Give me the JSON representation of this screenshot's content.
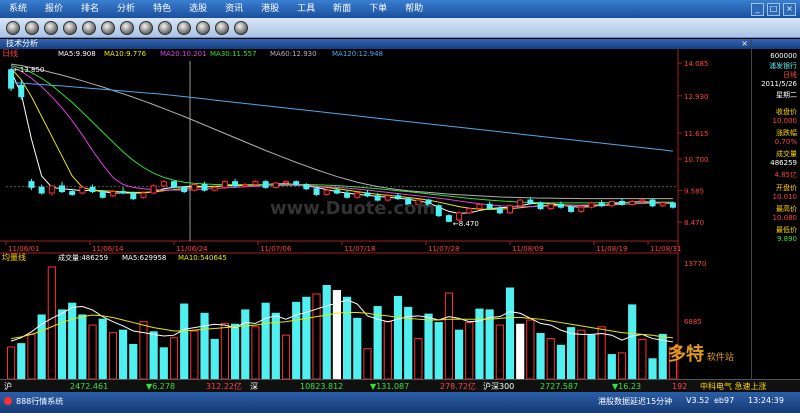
{
  "menu": {
    "items": [
      "系统",
      "报价",
      "排名",
      "分析",
      "特色",
      "选股",
      "资讯",
      "港股",
      "工具",
      "新面",
      "下单",
      "帮助"
    ]
  },
  "window": {
    "min": "_",
    "restore": "□",
    "close": "×"
  },
  "panel": {
    "title": "技术分析",
    "close": "×"
  },
  "chart_data": [
    {
      "type": "candlestick",
      "period_label": "日线",
      "indicator_labels": [
        "MA5:9.908",
        "MA10:9.776",
        "MA20:10.201",
        "MA30:11.557",
        "MA60:12.930",
        "MA120:12.948"
      ],
      "y_ticks": [
        "14.085",
        "12.930",
        "11.615",
        "10.700",
        "9.585",
        "8.470"
      ],
      "price_range": [
        8.3,
        14.3
      ],
      "x_ticks": [
        "11/06/01",
        "11/06/14",
        "11/06/24",
        "11/07/06",
        "11/07/18",
        "11/07/28",
        "11/08/09",
        "11/08/19",
        "11/08/31"
      ],
      "high_label": "13.850",
      "low_label": "8.470",
      "colors": {
        "up": "#ff3030",
        "down": "#50f0f0",
        "ma5": "#ffffff",
        "ma10": "#e8e800",
        "ma20": "#e040e0",
        "ma30": "#30e030",
        "ma60": "#b0b0b0",
        "ma120": "#4fa8e8"
      },
      "candles": [
        [
          13.85,
          13.9,
          13.2,
          13.1
        ],
        [
          13.3,
          13.5,
          12.9,
          12.8
        ],
        [
          9.9,
          10.0,
          9.7,
          9.6
        ],
        [
          9.7,
          9.8,
          9.5,
          9.45
        ],
        [
          9.5,
          9.75,
          9.75,
          9.4
        ],
        [
          9.75,
          9.9,
          9.55,
          9.5
        ],
        [
          9.55,
          9.65,
          9.45,
          9.4
        ],
        [
          9.5,
          9.7,
          9.7,
          9.45
        ],
        [
          9.7,
          9.8,
          9.55,
          9.5
        ],
        [
          9.55,
          9.6,
          9.35,
          9.3
        ],
        [
          9.4,
          9.6,
          9.55,
          9.35
        ],
        [
          9.55,
          9.7,
          9.5,
          9.45
        ],
        [
          9.5,
          9.55,
          9.3,
          9.25
        ],
        [
          9.35,
          9.55,
          9.5,
          9.3
        ],
        [
          9.5,
          9.8,
          9.75,
          9.45
        ],
        [
          9.75,
          9.95,
          9.9,
          9.7
        ],
        [
          9.9,
          9.95,
          9.7,
          9.65
        ],
        [
          9.7,
          9.75,
          9.55,
          9.5
        ],
        [
          9.6,
          9.85,
          9.8,
          9.55
        ],
        [
          9.8,
          9.9,
          9.6,
          9.55
        ],
        [
          9.6,
          9.75,
          9.7,
          9.55
        ],
        [
          9.7,
          9.95,
          9.9,
          9.65
        ],
        [
          9.9,
          10.0,
          9.75,
          9.7
        ],
        [
          9.75,
          9.85,
          9.8,
          9.7
        ],
        [
          9.8,
          9.95,
          9.9,
          9.75
        ],
        [
          9.9,
          9.95,
          9.7,
          9.65
        ],
        [
          9.7,
          9.9,
          9.85,
          9.65
        ],
        [
          9.85,
          9.95,
          9.9,
          9.8
        ],
        [
          9.9,
          9.95,
          9.8,
          9.75
        ],
        [
          9.8,
          9.85,
          9.65,
          9.6
        ],
        [
          9.65,
          9.7,
          9.45,
          9.4
        ],
        [
          9.45,
          9.65,
          9.6,
          9.4
        ],
        [
          9.6,
          9.7,
          9.5,
          9.45
        ],
        [
          9.5,
          9.6,
          9.35,
          9.3
        ],
        [
          9.35,
          9.55,
          9.5,
          9.3
        ],
        [
          9.5,
          9.6,
          9.4,
          9.35
        ],
        [
          9.4,
          9.5,
          9.25,
          9.2
        ],
        [
          9.25,
          9.45,
          9.4,
          9.2
        ],
        [
          9.4,
          9.5,
          9.3,
          9.25
        ],
        [
          9.3,
          9.35,
          9.1,
          9.05
        ],
        [
          9.1,
          9.3,
          9.25,
          9.05
        ],
        [
          9.25,
          9.3,
          9.05,
          9.0
        ],
        [
          9.05,
          9.1,
          8.7,
          8.65
        ],
        [
          8.7,
          8.75,
          8.5,
          8.47
        ],
        [
          8.55,
          8.85,
          8.8,
          8.5
        ],
        [
          8.8,
          9.0,
          8.95,
          8.75
        ],
        [
          8.95,
          9.15,
          9.1,
          8.9
        ],
        [
          9.1,
          9.2,
          8.95,
          8.9
        ],
        [
          8.95,
          9.05,
          8.8,
          8.75
        ],
        [
          8.8,
          9.1,
          9.05,
          8.75
        ],
        [
          9.05,
          9.3,
          9.25,
          9.0
        ],
        [
          9.25,
          9.35,
          9.15,
          9.1
        ],
        [
          9.15,
          9.2,
          8.95,
          8.9
        ],
        [
          8.95,
          9.15,
          9.1,
          8.9
        ],
        [
          9.1,
          9.2,
          9.0,
          8.95
        ],
        [
          9.0,
          9.05,
          8.85,
          8.8
        ],
        [
          8.85,
          9.05,
          9.0,
          8.8
        ],
        [
          9.0,
          9.2,
          9.15,
          8.95
        ],
        [
          9.15,
          9.25,
          9.05,
          9.0
        ],
        [
          9.05,
          9.2,
          9.2,
          9.0
        ],
        [
          9.2,
          9.3,
          9.1,
          9.05
        ],
        [
          9.1,
          9.25,
          9.2,
          9.05
        ],
        [
          9.2,
          9.3,
          9.25,
          9.1
        ],
        [
          9.25,
          9.3,
          9.05,
          9.0
        ],
        [
          9.05,
          9.2,
          9.15,
          9.0
        ],
        [
          9.15,
          9.2,
          9.0,
          8.95
        ]
      ],
      "ma_lines": {
        "ma5": [
          13.8,
          13.0,
          11.4,
          10.1,
          9.7,
          9.65,
          9.62,
          9.58,
          9.6,
          9.55,
          9.5,
          9.5,
          9.5,
          9.5,
          9.55,
          9.65,
          9.7,
          9.72,
          9.75,
          9.72,
          9.72,
          9.75,
          9.78,
          9.8,
          9.8,
          9.8,
          9.82,
          9.82,
          9.8,
          9.75,
          9.7,
          9.62,
          9.55,
          9.5,
          9.45,
          9.42,
          9.38,
          9.35,
          9.32,
          9.28,
          9.22,
          9.15,
          9.0,
          8.85,
          8.78,
          8.8,
          8.88,
          8.95,
          8.98,
          9.0,
          9.05,
          9.12,
          9.15,
          9.12,
          9.08,
          9.02,
          9.0,
          9.02,
          9.08,
          9.12,
          9.15,
          9.18,
          9.2,
          9.18,
          9.15,
          9.12
        ],
        "ma10": [
          13.9,
          13.5,
          12.9,
          12.2,
          11.5,
          10.8,
          10.1,
          9.7,
          9.6,
          9.58,
          9.56,
          9.54,
          9.52,
          9.52,
          9.54,
          9.58,
          9.62,
          9.66,
          9.7,
          9.72,
          9.74,
          9.75,
          9.76,
          9.77,
          9.78,
          9.8,
          9.8,
          9.8,
          9.8,
          9.78,
          9.74,
          9.7,
          9.65,
          9.6,
          9.55,
          9.5,
          9.45,
          9.42,
          9.38,
          9.34,
          9.3,
          9.25,
          9.18,
          9.1,
          9.02,
          8.96,
          8.93,
          8.92,
          8.93,
          8.95,
          8.98,
          9.02,
          9.05,
          9.07,
          9.08,
          9.07,
          9.06,
          9.05,
          9.06,
          9.08,
          9.1,
          9.12,
          9.14,
          9.15,
          9.15,
          9.14
        ],
        "ma20": [
          13.95,
          13.8,
          13.55,
          13.25,
          12.9,
          12.5,
          12.05,
          11.55,
          11.0,
          10.5,
          10.05,
          9.8,
          9.7,
          9.65,
          9.62,
          9.6,
          9.6,
          9.6,
          9.62,
          9.64,
          9.66,
          9.68,
          9.7,
          9.72,
          9.74,
          9.75,
          9.76,
          9.77,
          9.77,
          9.76,
          9.74,
          9.72,
          9.7,
          9.67,
          9.64,
          9.6,
          9.56,
          9.52,
          9.48,
          9.44,
          9.4,
          9.36,
          9.32,
          9.27,
          9.22,
          9.17,
          9.12,
          9.08,
          9.05,
          9.03,
          9.02,
          9.02,
          9.03,
          9.04,
          9.05,
          9.06,
          9.07,
          9.08,
          9.09,
          9.1,
          9.11,
          9.12,
          9.13,
          9.14,
          9.14,
          9.14
        ],
        "ma30": [
          14.0,
          13.9,
          13.75,
          13.55,
          13.3,
          13.0,
          12.7,
          12.35,
          12.0,
          11.65,
          11.3,
          10.95,
          10.65,
          10.4,
          10.2,
          10.05,
          9.95,
          9.88,
          9.84,
          9.82,
          9.8,
          9.8,
          9.8,
          9.8,
          9.8,
          9.8,
          9.8,
          9.8,
          9.8,
          9.8,
          9.79,
          9.78,
          9.76,
          9.74,
          9.71,
          9.68,
          9.65,
          9.62,
          9.58,
          9.55,
          9.51,
          9.47,
          9.43,
          9.39,
          9.35,
          9.31,
          9.28,
          9.25,
          9.22,
          9.2,
          9.18,
          9.17,
          9.16,
          9.15,
          9.15,
          9.15,
          9.15,
          9.15,
          9.16,
          9.16,
          9.17,
          9.17,
          9.18,
          9.18,
          9.18,
          9.18
        ],
        "ma60": [
          14.05,
          14.0,
          13.92,
          13.84,
          13.75,
          13.66,
          13.56,
          13.46,
          13.35,
          13.24,
          13.12,
          13.0,
          12.88,
          12.75,
          12.62,
          12.48,
          12.34,
          12.2,
          12.05,
          11.9,
          11.75,
          11.6,
          11.45,
          11.3,
          11.15,
          11.0,
          10.86,
          10.72,
          10.58,
          10.45,
          10.32,
          10.2,
          10.08,
          9.98,
          9.88,
          9.8,
          9.73,
          9.67,
          9.62,
          9.58,
          9.55,
          9.52,
          9.49,
          9.46,
          9.44,
          9.42,
          9.4,
          9.38,
          9.36,
          9.35,
          9.34,
          9.33,
          9.32,
          9.32,
          9.31,
          9.31,
          9.3,
          9.3,
          9.3,
          9.3,
          9.3,
          9.3,
          9.3,
          9.3,
          9.3,
          9.3
        ],
        "ma120": [
          13.4,
          13.38,
          13.35,
          13.33,
          13.3,
          13.28,
          13.25,
          13.22,
          13.19,
          13.16,
          13.13,
          13.1,
          13.07,
          13.04,
          13.01,
          12.98,
          12.94,
          12.9,
          12.86,
          12.82,
          12.78,
          12.74,
          12.7,
          12.66,
          12.62,
          12.58,
          12.54,
          12.5,
          12.46,
          12.42,
          12.38,
          12.34,
          12.3,
          12.26,
          12.22,
          12.18,
          12.14,
          12.1,
          12.06,
          12.02,
          11.98,
          11.94,
          11.9,
          11.86,
          11.82,
          11.78,
          11.74,
          11.7,
          11.66,
          11.62,
          11.58,
          11.54,
          11.5,
          11.46,
          11.42,
          11.38,
          11.34,
          11.3,
          11.26,
          11.22,
          11.18,
          11.14,
          11.1,
          11.06,
          11.02,
          10.98
        ]
      }
    },
    {
      "type": "bar",
      "period_label": "均量线",
      "indicator_labels": [
        "成交量:486259",
        "MA5:629958",
        "MA10:540645"
      ],
      "y_ticks": [
        "13770",
        "6885"
      ],
      "range": [
        0,
        13770
      ],
      "values": [
        3800,
        4200,
        5300,
        7600,
        13300,
        8200,
        9000,
        7600,
        6400,
        7100,
        5500,
        5800,
        4100,
        6800,
        5600,
        3700,
        4900,
        8900,
        5700,
        7800,
        4700,
        6600,
        6500,
        8200,
        6200,
        9000,
        7800,
        5200,
        9100,
        9700,
        10100,
        11100,
        10500,
        9700,
        7200,
        3600,
        8600,
        6800,
        9800,
        8500,
        4800,
        7700,
        6700,
        10200,
        5800,
        6700,
        8300,
        8200,
        6400,
        10800,
        6500,
        7000,
        5400,
        4800,
        4000,
        6100,
        5800,
        5200,
        6200,
        2900,
        3100,
        8800,
        4700,
        2400,
        5300,
        3700
      ],
      "up": [
        true,
        false,
        true,
        false,
        true,
        false,
        false,
        false,
        true,
        false,
        true,
        false,
        false,
        true,
        false,
        false,
        true,
        false,
        true,
        false,
        false,
        true,
        false,
        false,
        true,
        false,
        false,
        true,
        false,
        false,
        true,
        false,
        true,
        false,
        false,
        true,
        false,
        true,
        false,
        false,
        true,
        false,
        false,
        true,
        false,
        true,
        false,
        false,
        true,
        false,
        false,
        true,
        false,
        true,
        false,
        false,
        true,
        false,
        true,
        false,
        true,
        false,
        true,
        false,
        false,
        true
      ],
      "white_bars": [
        32,
        50
      ],
      "ma5": [
        4500,
        4900,
        5600,
        6500,
        7200,
        7800,
        8500,
        8600,
        8200,
        7400,
        6800,
        6300,
        5700,
        5500,
        5300,
        5100,
        5200,
        5900,
        6100,
        6300,
        6500,
        6400,
        6100,
        6700,
        6600,
        7200,
        7500,
        7100,
        7600,
        7900,
        8300,
        8700,
        9000,
        9400,
        8900,
        7500,
        7100,
        6800,
        7100,
        7400,
        7500,
        7300,
        7000,
        7400,
        7200,
        6800,
        6900,
        7300,
        7400,
        8000,
        7800,
        7200,
        6600,
        6400,
        5800,
        5400,
        5300,
        5300,
        5400,
        5200,
        4600,
        5100,
        5300,
        4800,
        4600,
        4400
      ],
      "ma10": [
        4800,
        5000,
        5300,
        5700,
        6200,
        6700,
        7100,
        7400,
        7600,
        7500,
        7300,
        7000,
        6700,
        6400,
        6100,
        5900,
        5700,
        5700,
        5800,
        5900,
        6000,
        6100,
        6200,
        6300,
        6400,
        6600,
        6700,
        6800,
        7000,
        7200,
        7400,
        7600,
        7800,
        7900,
        7900,
        7800,
        7600,
        7500,
        7300,
        7200,
        7100,
        7000,
        7000,
        7100,
        7100,
        7100,
        7100,
        7100,
        7200,
        7300,
        7300,
        7200,
        7100,
        6900,
        6700,
        6500,
        6300,
        6100,
        5900,
        5700,
        5500,
        5400,
        5300,
        5200,
        5000,
        4900
      ]
    }
  ],
  "sidebar": {
    "code": "600000",
    "name": "浦发银行",
    "period": "日线",
    "date": "2011/5/26",
    "weekday": "星期二",
    "close_label": "收盘价",
    "close_value": "10.000",
    "change_label": "涨跌幅",
    "change_value": "0.70%",
    "volume_label": "成交量",
    "volume_value": "486259",
    "turnover_value": "4.85亿",
    "open_label": "开盘价",
    "open_value": "10.010",
    "high_label": "最高价",
    "high_value": "10.080",
    "low_label": "最低价",
    "low_value": "9.890"
  },
  "status": {
    "sh_label": "沪",
    "sh_index": "2472.461",
    "sh_change": "▼6.278",
    "sh_amount": "312.22亿",
    "sz_label": "深",
    "sz_index": "10823.812",
    "sz_change": "▼131.087",
    "sz_amount": "278.72亿",
    "hs300_label": "沪深300",
    "hs300_index": "2727.587",
    "hs300_change": "▼16.23",
    "hs300_amount": "192",
    "stock_label": "中科电气 急速上涨"
  },
  "bottom": {
    "app_name": "888行情系统",
    "hk_delay": "港股数据延迟15分钟",
    "version": "V3.52",
    "server": "eb97",
    "time": "13:24:39"
  },
  "watermark": {
    "text": "www.Duote.com",
    "logo_text": "多特",
    "logo_suffix": "软件站"
  }
}
